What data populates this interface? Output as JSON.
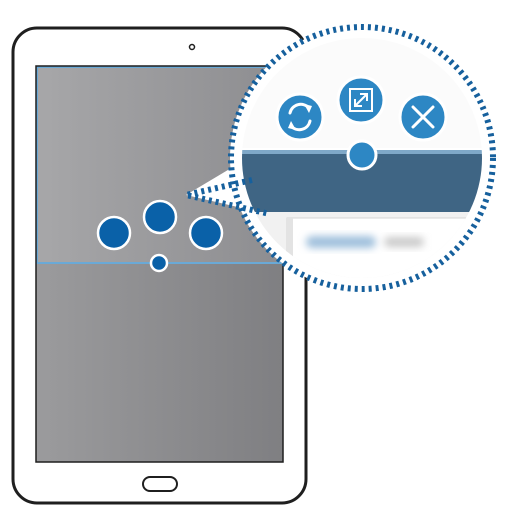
{
  "illustration": {
    "description_free": true
  },
  "tablet": {
    "camera": "camera-dot",
    "home_button": "home-button"
  },
  "split_window": {
    "controls": [
      {
        "icon": "switch-windows-icon"
      },
      {
        "icon": "maximize-window-icon"
      },
      {
        "icon": "close-window-icon"
      }
    ]
  },
  "colors": {
    "accent_blue": "#0a61a8",
    "zoom_blue": "#2d87c4",
    "bar_dark": "#3f6584",
    "screen_top": "#a9a9ab",
    "screen_bottom": "#8f8f91",
    "outline": "#1f1f1f",
    "selection_border": "#6aa9d6",
    "dotted_border": "#16609d"
  }
}
